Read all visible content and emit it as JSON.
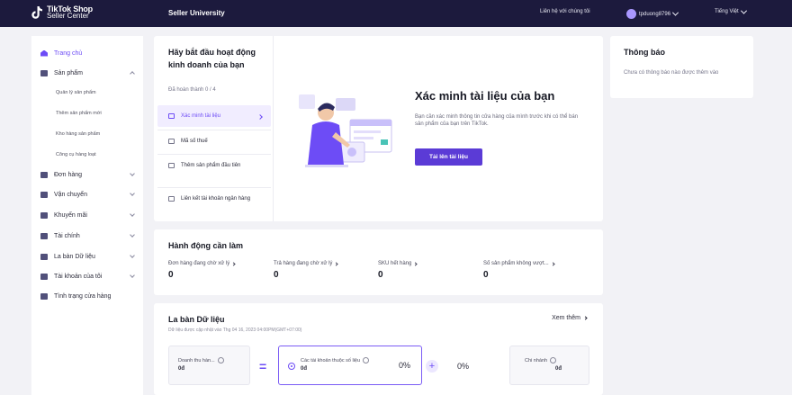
{
  "topbar": {
    "logo_line1": "TikTok Shop",
    "logo_line2": "Seller Center",
    "section_title": "Seller University",
    "contact": "Liên hệ với chúng tôi",
    "account": "tpduong8796",
    "language": "Tiếng Việt"
  },
  "sidebar": {
    "items": [
      {
        "label": "Trang chủ",
        "icon": "home-icon"
      },
      {
        "label": "Sản phẩm",
        "icon": "product-icon"
      },
      {
        "label": "Đơn hàng",
        "icon": "order-icon"
      },
      {
        "label": "Vận chuyển",
        "icon": "shipping-icon"
      },
      {
        "label": "Khuyến mãi",
        "icon": "promotion-icon"
      },
      {
        "label": "Tài chính",
        "icon": "finance-icon"
      },
      {
        "label": "La bàn Dữ liệu",
        "icon": "compass-icon"
      },
      {
        "label": "Tài khoản của tôi",
        "icon": "account-icon"
      },
      {
        "label": "Tình trạng cửa hàng",
        "icon": "shop-health-icon"
      }
    ],
    "sub_items": [
      "Quản lý sản phẩm",
      "Thêm sản phẩm mới",
      "Kho hàng sản phẩm",
      "Công cụ hàng loạt"
    ]
  },
  "onboarding": {
    "title": "Hãy bắt đầu hoạt động kinh doanh của bạn",
    "progress": "Đã hoàn thành 0 / 4",
    "steps": [
      {
        "label": "Xác minh tài liệu"
      },
      {
        "label": "Mã số thuế"
      },
      {
        "label": "Thêm sản phẩm đầu tiên"
      },
      {
        "label": "Liên kết tài khoản ngân hàng"
      }
    ],
    "verify_title": "Xác minh tài liệu của bạn",
    "verify_desc": "Bạn cần xác minh thông tin cửa hàng của mình trước khi có thể bán sản phẩm của bạn trên TikTok.",
    "upload_button": "Tải lên tài liệu"
  },
  "notifications": {
    "title": "Thông báo",
    "empty_text": "Chưa có thông báo nào được thêm vào"
  },
  "actions": {
    "title": "Hành động cần làm",
    "items": [
      {
        "label": "Đơn hàng đang chờ xử lý",
        "value": "0"
      },
      {
        "label": "Trả hàng đang chờ xử lý",
        "value": "0"
      },
      {
        "label": "SKU hết hàng",
        "value": "0"
      },
      {
        "label": "Số sản phẩm không vượt...",
        "value": "0"
      }
    ]
  },
  "compass": {
    "title": "La bàn Dữ liệu",
    "subtitle": "Dữ liệu được cập nhật vào Thg 04 16, 2023 04:00PM(GMT+07:00)",
    "view_more": "Xem thêm",
    "metrics": [
      {
        "label": "Doanh thu hàn...",
        "value": "0đ"
      },
      {
        "label": "Các tài khoản thuộc số liệu",
        "value": "0đ",
        "pct": "0%"
      },
      {
        "label": "Chi nhánh",
        "value": "0đ"
      }
    ],
    "equals": "=",
    "plus": "+",
    "free_pct": "0%"
  },
  "colors": {
    "accent": "#6d4cf6",
    "topbar": "#1c1a3d",
    "button": "#5b3bd6"
  }
}
